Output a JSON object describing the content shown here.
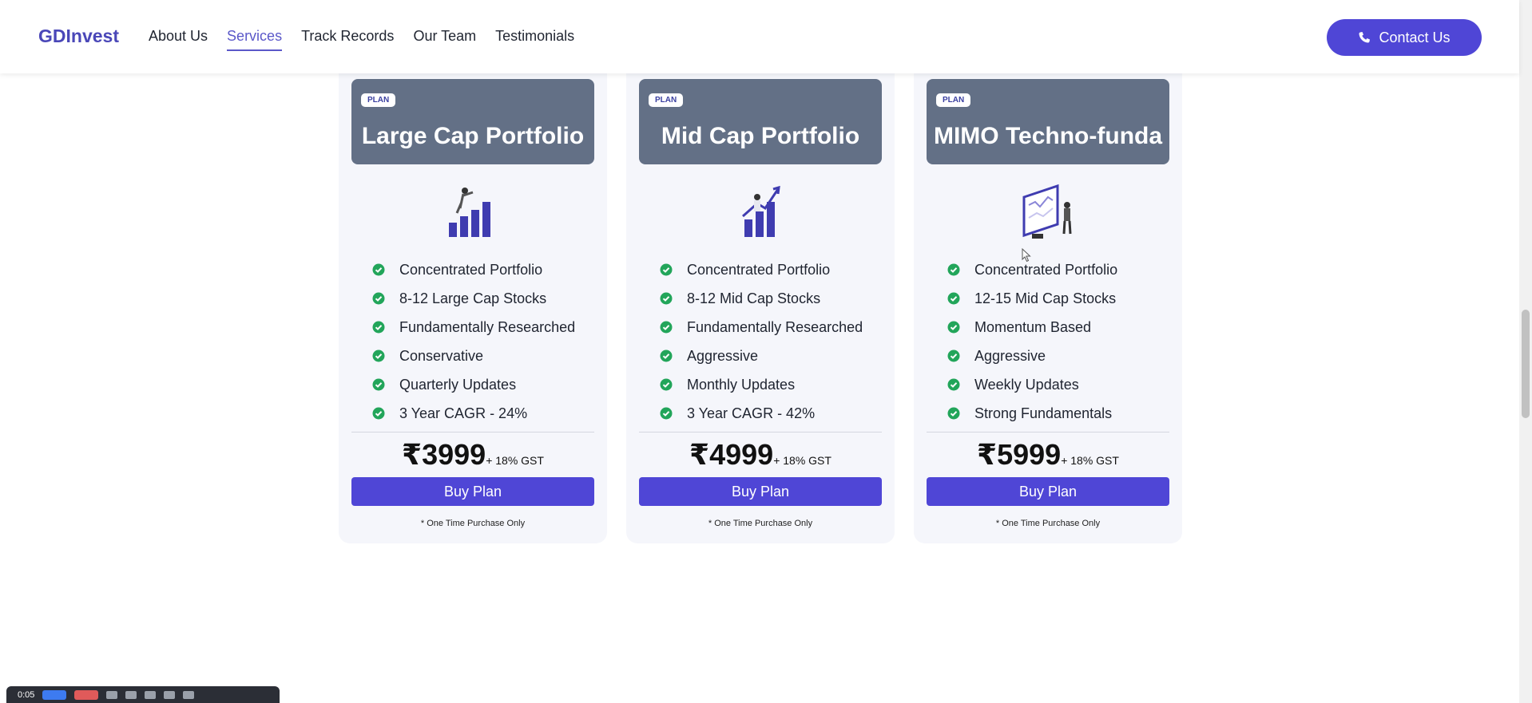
{
  "header": {
    "logo": "GDInvest",
    "nav": [
      {
        "label": "About Us",
        "active": false
      },
      {
        "label": "Services",
        "active": true
      },
      {
        "label": "Track Records",
        "active": false
      },
      {
        "label": "Our Team",
        "active": false
      },
      {
        "label": "Testimonials",
        "active": false
      }
    ],
    "contact_label": "Contact Us"
  },
  "plans": [
    {
      "badge": "PLAN",
      "title": "Large Cap Portfolio",
      "features": [
        "Concentrated Portfolio",
        "8-12 Large Cap Stocks",
        "Fundamentally Researched",
        "Conservative",
        "Quarterly Updates",
        "3 Year CAGR - 24%"
      ],
      "price": "₹3999",
      "gst": "+ 18% GST",
      "buy_label": "Buy Plan",
      "note": "* One Time Purchase Only"
    },
    {
      "badge": "PLAN",
      "title": "Mid Cap Portfolio",
      "features": [
        "Concentrated Portfolio",
        "8-12 Mid Cap Stocks",
        "Fundamentally Researched",
        "Aggressive",
        "Monthly Updates",
        "3 Year CAGR - 42%"
      ],
      "price": "₹4999",
      "gst": "+ 18% GST",
      "buy_label": "Buy Plan",
      "note": "* One Time Purchase Only"
    },
    {
      "badge": "PLAN",
      "title": "MIMO Techno-funda",
      "features": [
        "Concentrated Portfolio",
        "12-15 Mid Cap Stocks",
        "Momentum Based",
        "Aggressive",
        "Weekly Updates",
        "Strong Fundamentals"
      ],
      "price": "₹5999",
      "gst": "+ 18% GST",
      "buy_label": "Buy Plan",
      "note": "* One Time Purchase Only"
    }
  ],
  "recorder": {
    "time": "0:05"
  },
  "colors": {
    "brand": "#4a47b8",
    "button": "#4f46d6",
    "card_head": "#637086",
    "check": "#22a55a"
  }
}
